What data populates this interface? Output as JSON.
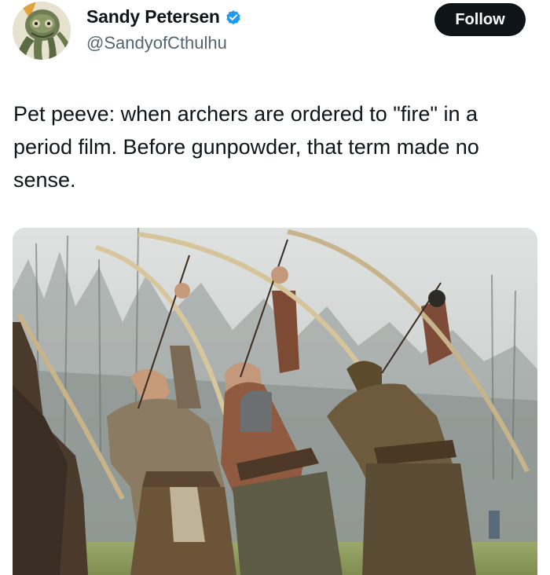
{
  "author": {
    "display_name": "Sandy Petersen",
    "handle": "@SandyofCthulhu",
    "verified_icon": "verified-badge-icon",
    "badge_color": "#1d9bf0"
  },
  "actions": {
    "follow_label": "Follow"
  },
  "tweet": {
    "text": "Pet peeve: when archers are ordered to \"fire\" in a period film. Before gunpowder, that term made no sense."
  },
  "media": {
    "type": "photo",
    "subject": "four-archers-drawing-longbows-upward"
  },
  "colors": {
    "text_primary": "#0f1419",
    "text_secondary": "#536471",
    "follow_bg": "#0f1419",
    "follow_text": "#ffffff"
  }
}
